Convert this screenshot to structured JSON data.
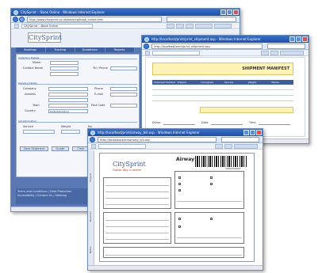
{
  "window_back": {
    "title": "CitySprint :: Book Online - Windows Internet Explorer",
    "url": "http://www.citysprint.co.uk/booking/book_online.html",
    "tab_label": "CitySprint :: Book Online",
    "logo_text": "CitySprint",
    "menu": [
      "Bookings",
      "Tracking",
      "Quotations",
      "Reports"
    ],
    "sections": {
      "pickup": "Collection Details",
      "delivery": "Delivery Details",
      "job": "Job Information"
    },
    "fields": {
      "name_label": "Name",
      "contact_label": "Contact Name",
      "tel_label": "Tel / Phone",
      "company_label": "Company",
      "address_label": "Address",
      "town_label": "Town",
      "country_label": "Country",
      "country_value": "United Kingdom",
      "phone_label": "Phone",
      "email_label": "E-mail",
      "postcode_label": "Post Code",
      "service_label": "Service",
      "weight_label": "Weight",
      "pieces_label": "No"
    },
    "buttons": {
      "save": "Save Shipment",
      "quote": "Quote",
      "clear": "Clear"
    },
    "footer_line1": "Terms and Conditions  |  Data Protection",
    "footer_line2": "Accessibility  |  Contact Us  |  Sitemap"
  },
  "window_middle": {
    "title": "http://localhost/print/print_shipment.asp - Windows Internet Explorer",
    "url": "http://localhost/print/print_shipment.asp",
    "heading": "SHIPMENT MANIFEST",
    "columns": [
      "Shipment Number",
      "Shipper",
      "Consignee",
      "Service",
      "Weight",
      "Pieces"
    ],
    "signature_labels": [
      "Driver",
      "Date",
      "Time"
    ]
  },
  "window_front": {
    "title": "http://localhost/print/airway_bill.asp - Windows Internet Explorer",
    "url": "http://localhost/print/airway_bill.asp",
    "doc_title": "Airway Bill",
    "logo_text": "CitySprint",
    "logo_sub": "Same day courier",
    "barcode_number": "*000000000*",
    "side_tabs": [
      "Shipper",
      "Receiver",
      "Notes"
    ]
  },
  "colors": {
    "ie_title": "#1d4fa8",
    "app_blue": "#5a78b4",
    "manifest_highlight": "#fff3b8"
  }
}
